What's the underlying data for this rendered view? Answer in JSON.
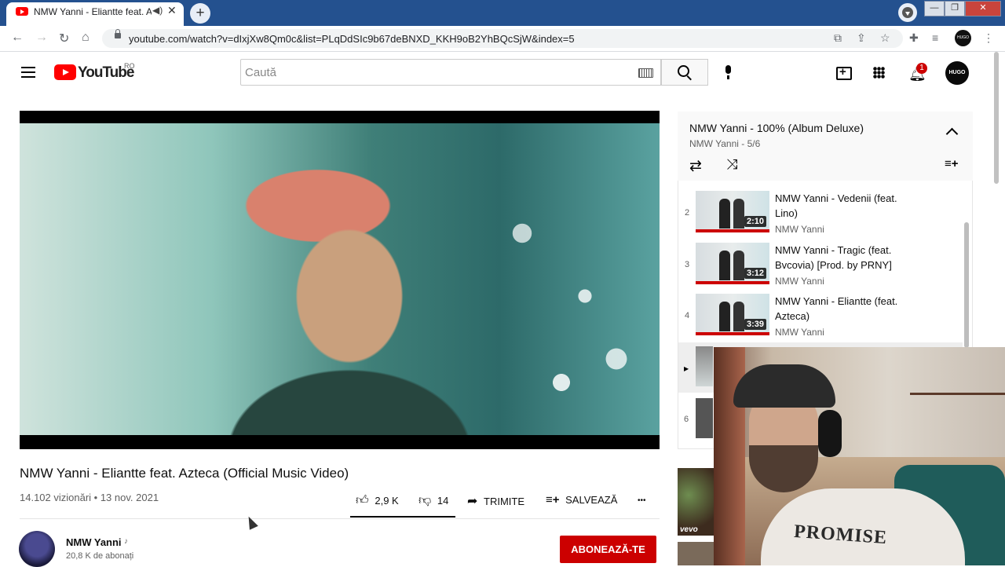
{
  "browser": {
    "tab_title": "NMW Yanni - Eliantte feat. A",
    "url": "youtube.com/watch?v=dIxjXw8Qm0c&list=PLqDdSIc9b67deBNXD_KKH9oB2YhBQcSjW&index=5",
    "profile_label": "HUGO"
  },
  "masthead": {
    "logo_text": "YouTube",
    "country": "RO",
    "search_placeholder": "Caută",
    "notification_count": "1",
    "avatar_label": "HUGO"
  },
  "video": {
    "title": "NMW Yanni - Eliantte feat. Azteca (Official Music Video)",
    "meta": "14.102 vizionări • 13 nov. 2021",
    "likes": "2,9 K",
    "dislikes": "14",
    "share_label": "TRIMITE",
    "save_label": "SALVEAZĂ",
    "more_label": "•••"
  },
  "channel": {
    "name": "NMW Yanni",
    "subscribers": "20,8 K de abonați",
    "subscribe_label": "ABONEAZĂ-TE"
  },
  "playlist": {
    "title": "NMW Yanni - 100% (Album Deluxe)",
    "subtitle": "NMW Yanni - 5/6",
    "items": [
      {
        "index": "2",
        "title": "NMW Yanni - Vedenii (feat. Lino)",
        "channel": "NMW Yanni",
        "duration": "2:10"
      },
      {
        "index": "3",
        "title": "NMW Yanni - Tragic (feat. Bvcovia) [Prod. by PRNY]",
        "channel": "NMW Yanni",
        "duration": "3:12"
      },
      {
        "index": "4",
        "title": "NMW Yanni - Eliantte (feat. Azteca)",
        "channel": "NMW Yanni",
        "duration": "3:39"
      }
    ],
    "current_marker": "▶",
    "last_index": "6"
  },
  "related": {
    "badge": "vevo"
  },
  "webcam": {
    "shirt_text": "PROMISE"
  }
}
